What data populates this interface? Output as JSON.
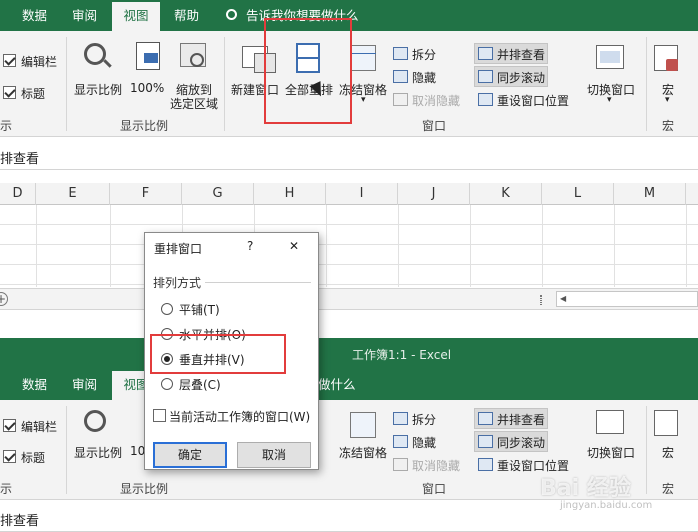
{
  "top": {
    "tabs": [
      {
        "label": "数据"
      },
      {
        "label": "审阅"
      },
      {
        "label": "视图"
      },
      {
        "label": "帮助"
      }
    ],
    "tell_me": "告诉我你想要做什么",
    "ribbon": {
      "show_checks": [
        {
          "label": "编辑栏",
          "checked": true
        },
        {
          "label": "标题",
          "checked": true
        }
      ],
      "show_group_label": "示",
      "zoom_buttons": [
        {
          "label": "显示比例"
        },
        {
          "label": "100%"
        },
        {
          "label": "缩放到",
          "label2": "选定区域"
        }
      ],
      "zoom_group_label": "显示比例",
      "window_buttons": [
        {
          "label": "新建窗口"
        },
        {
          "label": "全部重排"
        },
        {
          "label": "冻结窗格"
        }
      ],
      "window_small": [
        {
          "label": "拆分"
        },
        {
          "label": "隐藏"
        },
        {
          "label": "取消隐藏",
          "disabled": true
        }
      ],
      "window_right": [
        {
          "label": "并排查看",
          "highlighted": true
        },
        {
          "label": "同步滚动",
          "highlighted": true
        },
        {
          "label": "重设窗口位置"
        }
      ],
      "switch_label": "切换窗口",
      "window_group_label": "窗口",
      "macro_label": "宏",
      "macro_group_label": "宏"
    },
    "formula_text": "排查看"
  },
  "grid": {
    "columns": [
      "D",
      "E",
      "F",
      "G",
      "H",
      "I",
      "J",
      "K",
      "L",
      "M"
    ]
  },
  "second": {
    "title": "工作簿1:1  -  Excel",
    "tabs": [
      {
        "label": "数据"
      },
      {
        "label": "审阅"
      },
      {
        "label": "视图"
      }
    ],
    "tell_me_partial": "做什么",
    "ribbon": {
      "show_checks": [
        {
          "label": "编辑栏",
          "checked": true
        },
        {
          "label": "标题",
          "checked": true
        }
      ],
      "show_group_label": "示",
      "zoom_label": "显示比例",
      "zoom_partial": "10",
      "zoom_group_label": "显示比例",
      "freeze_label": "冻结窗格",
      "window_small": [
        {
          "label": "拆分"
        },
        {
          "label": "隐藏"
        },
        {
          "label": "取消隐藏",
          "disabled": true
        }
      ],
      "window_right": [
        {
          "label": "并排查看",
          "highlighted": true
        },
        {
          "label": "同步滚动",
          "highlighted": true
        },
        {
          "label": "重设窗口位置"
        }
      ],
      "switch_label": "切换窗口",
      "window_group_label": "窗口",
      "macro_label": "宏",
      "macro_group_label": "宏"
    },
    "formula_text": "排查看"
  },
  "dialog": {
    "title": "重排窗口",
    "help": "?",
    "close": "✕",
    "section": "排列方式",
    "options": [
      {
        "label": "平铺(T)",
        "selected": false
      },
      {
        "label": "水平并排(O)",
        "selected": false
      },
      {
        "label": "垂直并排(V)",
        "selected": true
      },
      {
        "label": "层叠(C)",
        "selected": false
      }
    ],
    "checkbox_label": "当前活动工作簿的窗口(W)",
    "ok": "确定",
    "cancel": "取消"
  },
  "watermark": "Bai 经验",
  "watermark_url": "jingyan.baidu.com",
  "colors": {
    "excel_green": "#217346",
    "highlight_red": "#e23c3c"
  }
}
